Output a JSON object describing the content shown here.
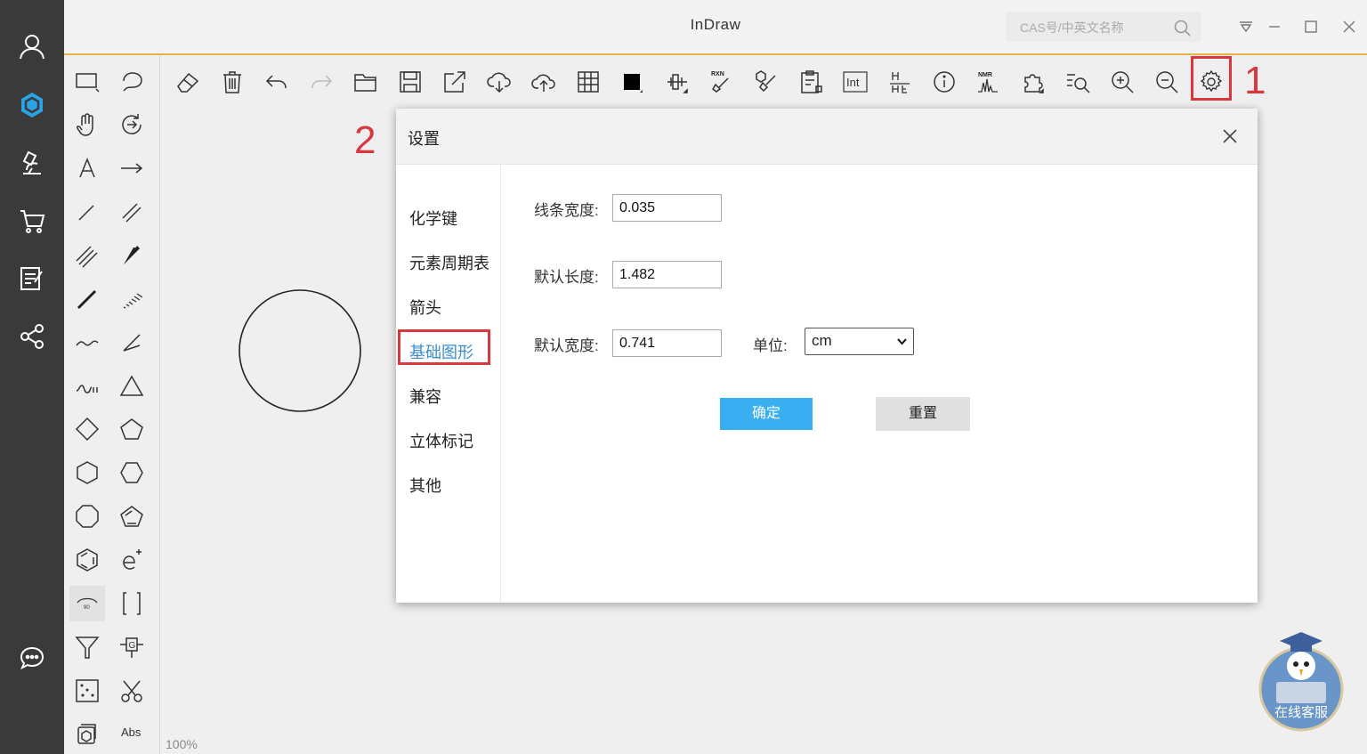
{
  "app": {
    "title": "InDraw"
  },
  "search": {
    "placeholder": "CAS号/中英文名称"
  },
  "annotations": {
    "marker1": "1",
    "marker2": "2"
  },
  "status": {
    "zoom": "100%"
  },
  "toolbar_text": {
    "int": "Int",
    "rxn": "RXN",
    "nmr": "NMR",
    "abs": "Abs",
    "g": "G",
    "angle": "90"
  },
  "dialog": {
    "title": "设置",
    "menu": [
      "化学键",
      "元素周期表",
      "箭头",
      "基础图形",
      "兼容",
      "立体标记",
      "其他"
    ],
    "active_menu_index": 3,
    "fields": {
      "line_width": {
        "label": "线条宽度:",
        "value": "0.035"
      },
      "default_length": {
        "label": "默认长度:",
        "value": "1.482"
      },
      "default_width": {
        "label": "默认宽度:",
        "value": "0.741"
      },
      "unit": {
        "label": "单位:",
        "value": "cm"
      }
    },
    "ok_label": "确定",
    "reset_label": "重置"
  },
  "chat": {
    "label": "在线客服"
  },
  "colors": {
    "accent": "#39aef0",
    "highlight": "#d9363e",
    "nav_bg": "#3a3a3a",
    "title_border": "#e6b34c",
    "active_menu": "#3b8fd0"
  }
}
